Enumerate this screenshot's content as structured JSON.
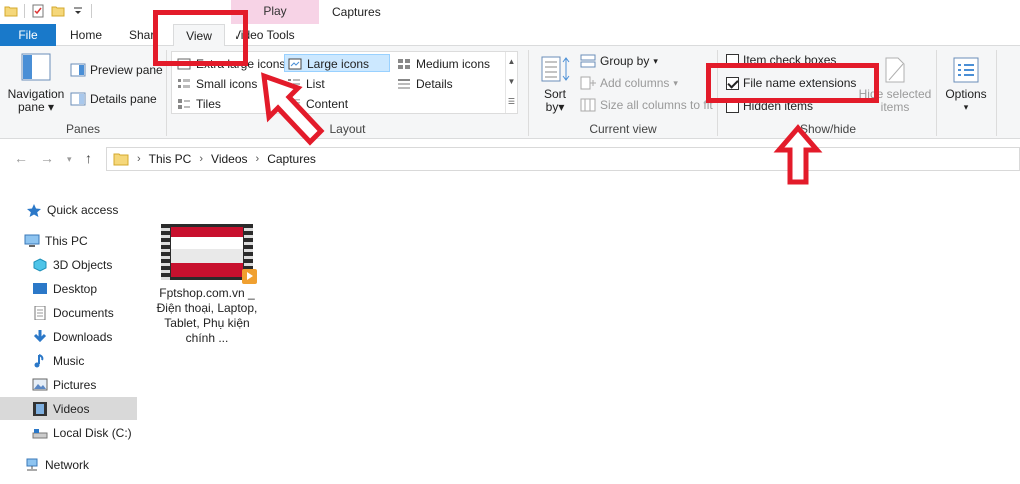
{
  "window": {
    "title": "Captures",
    "context_tab_group": "Play"
  },
  "tabs": {
    "file": "File",
    "home": "Home",
    "share": "Share",
    "view": "View",
    "video_tools": "Video Tools"
  },
  "ribbon": {
    "panes": {
      "label": "Panes",
      "navigation_pane_line1": "Navigation",
      "navigation_pane_line2": "pane",
      "preview_pane": "Preview pane",
      "details_pane": "Details pane"
    },
    "layout": {
      "label": "Layout",
      "extra_large_icons": "Extra large icons",
      "large_icons": "Large icons",
      "medium_icons": "Medium icons",
      "small_icons": "Small icons",
      "list": "List",
      "details": "Details",
      "tiles": "Tiles",
      "content": "Content"
    },
    "current_view": {
      "label": "Current view",
      "sort_line1": "Sort",
      "sort_line2": "by",
      "group_by": "Group by",
      "add_columns": "Add columns",
      "size_all_columns": "Size all columns to fit"
    },
    "show_hide": {
      "label": "Show/hide",
      "item_check_boxes": "Item check boxes",
      "file_name_extensions": "File name extensions",
      "hidden_items": "Hidden items",
      "hide_selected_line1": "Hide selected",
      "hide_selected_line2": "items"
    },
    "options": {
      "label": "Options"
    }
  },
  "address": {
    "path": [
      "This PC",
      "Videos",
      "Captures"
    ]
  },
  "nav_pane": {
    "items": [
      {
        "label": "Quick access"
      },
      {
        "label": "This PC"
      },
      {
        "label": "3D Objects"
      },
      {
        "label": "Desktop"
      },
      {
        "label": "Documents"
      },
      {
        "label": "Downloads"
      },
      {
        "label": "Music"
      },
      {
        "label": "Pictures"
      },
      {
        "label": "Videos"
      },
      {
        "label": "Local Disk (C:)"
      },
      {
        "label": "Network"
      }
    ]
  },
  "files": [
    {
      "name": "Fptshop.com.vn _ Điện thoại, Laptop, Tablet, Phụ kiện chính ..."
    }
  ],
  "colors": {
    "file_tab": "#1979ca",
    "annotation": "#e31b2a",
    "context_tab": "#f7d3e6",
    "selection": "#cce8ff"
  }
}
